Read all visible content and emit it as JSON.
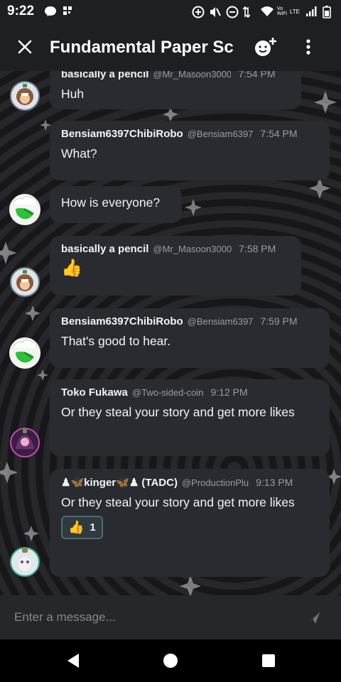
{
  "status_bar": {
    "time": "9:22",
    "left_icons": [
      "messenger-icon",
      "grid-icon"
    ],
    "right_icons": [
      "data-saver-icon",
      "mute-icon",
      "dnd-icon",
      "wifi-icon",
      "signal-icon",
      "battery-icon"
    ],
    "wifi_label": "Vo WiFi",
    "lte_label": "LTE"
  },
  "header": {
    "title": "Fundamental Paper Sc"
  },
  "messages": [
    {
      "author": "basically a pencil",
      "handle": "@Mr_Masoon3000",
      "time": "7:54 PM",
      "text": "Huh"
    },
    {
      "author": "Bensiam6397ChibiRobo",
      "handle": "@Bensiam6397",
      "time": "7:54 PM",
      "text": "What?"
    },
    {
      "text": "How is everyone?"
    },
    {
      "author": "basically a pencil",
      "handle": "@Mr_Masoon3000",
      "time": "7:58 PM",
      "text": "👍"
    },
    {
      "author": "Bensiam6397ChibiRobo",
      "handle": "@Bensiam6397",
      "time": "7:59 PM",
      "text": "That's good to hear."
    },
    {
      "author": "Toko Fukawa",
      "handle": "@Two-sided-coin",
      "time": "9:12 PM",
      "text": "Or they steal your story and get more likes"
    },
    {
      "author": "♟🦋kinger🦋♟ (TADC)",
      "handle": "@ProductionPlu",
      "time": "9:13 PM",
      "text": "Or they steal your story and get more likes",
      "reaction": {
        "emoji": "👍",
        "count": "1"
      }
    }
  ],
  "composer": {
    "placeholder": "Enter a message..."
  },
  "colors": {
    "background": "#000000",
    "bubble": "#2a2b31",
    "app_bar": "#1e1f22",
    "reaction_border": "#4c6b74",
    "muted_text": "#9a9ca3"
  }
}
